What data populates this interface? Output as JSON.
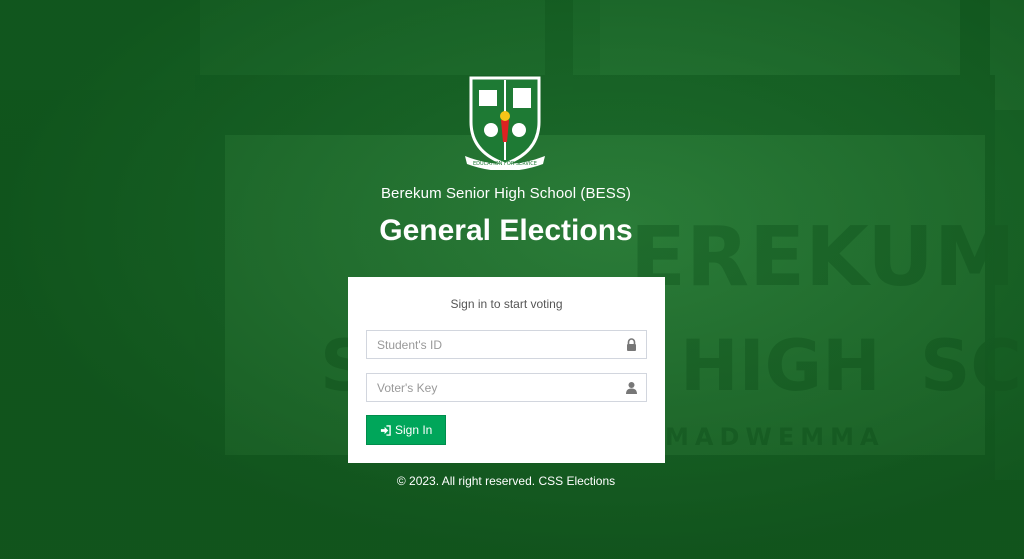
{
  "school": {
    "name": "Berekum Senior High School (BESS)",
    "crest_motto": "EDUCATION FOR SERVICE"
  },
  "page": {
    "title": "General Elections"
  },
  "login": {
    "message": "Sign in to start voting",
    "student_id_placeholder": "Student's ID",
    "voter_key_placeholder": "Voter's Key",
    "student_id_icon": "lock-icon",
    "voter_key_icon": "user-icon",
    "signin_icon": "sign-in-icon",
    "signin_label": "Sign In"
  },
  "footer": {
    "text": "© 2023. All right reserved. CSS Elections"
  },
  "colors": {
    "background_tint": "#1f6a2c",
    "button": "#00a65a",
    "box": "#ffffff"
  }
}
